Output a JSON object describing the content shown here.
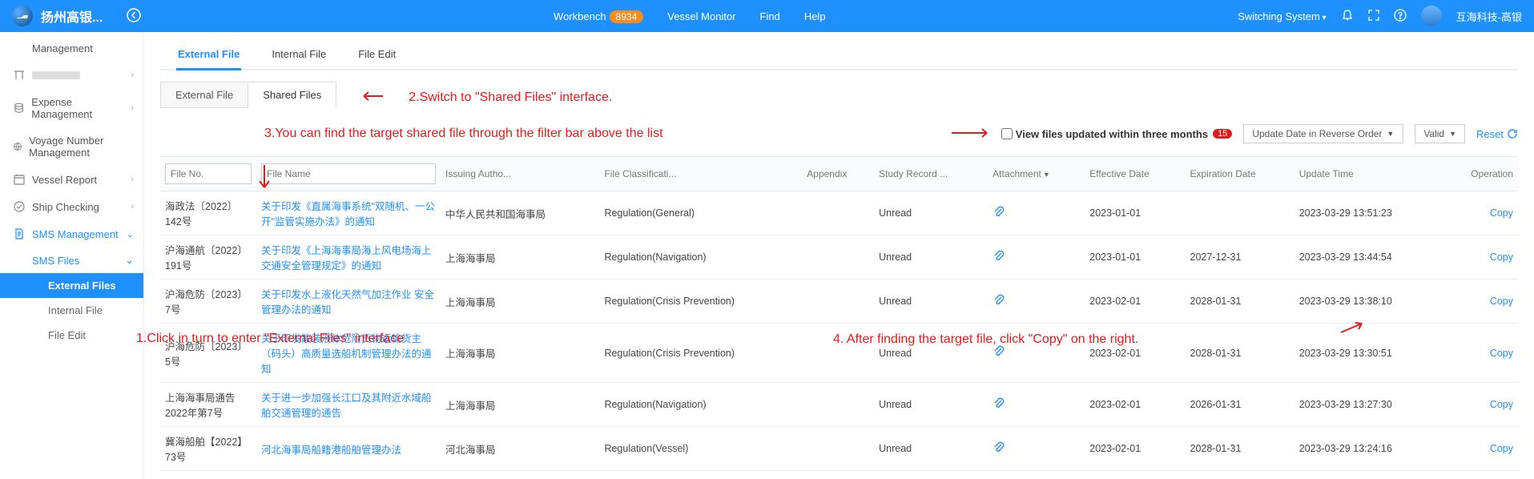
{
  "header": {
    "app_title": "扬州高银...",
    "nav": {
      "workbench": "Workbench",
      "workbench_badge": "8934",
      "vessel_monitor": "Vessel Monitor",
      "find": "Find",
      "help": "Help"
    },
    "right": {
      "switching": "Switching System",
      "user": "互海科技-高银"
    }
  },
  "sidebar": {
    "management": "Management",
    "blurred": "",
    "expense": "Expense Management",
    "voyage": "Voyage Number Management",
    "vessel_report": "Vessel Report",
    "ship_checking": "Ship Checking",
    "sms": "SMS Management",
    "sms_files": "SMS Files",
    "external_files": "External Files",
    "internal_file": "Internal File",
    "file_edit": "File Edit"
  },
  "tabs": {
    "external_file": "External File",
    "internal_file": "Internal File",
    "file_edit": "File Edit"
  },
  "subtabs": {
    "external_file": "External File",
    "shared_files": "Shared Files"
  },
  "notes": {
    "n1": "1.Click in turn to enter \"External Files\" interface",
    "n2": "2.Switch to \"Shared Files\" interface.",
    "n3": "3.You can find the target shared file through the filter bar above the list",
    "n4": "4. After finding the target file, click \"Copy\" on the right."
  },
  "filters": {
    "view_three_months": "View files updated within three months",
    "view_badge": "15",
    "order": "Update Date in Reverse Order",
    "valid": "Valid",
    "reset": "Reset"
  },
  "columns": {
    "file_no": "File No.",
    "file_name": "File Name",
    "issuing": "Issuing Autho...",
    "classification": "File Classificati...",
    "appendix": "Appendix",
    "study": "Study Record ...",
    "attachment": "Attachment",
    "effective": "Effective Date",
    "expiration": "Expiration Date",
    "update": "Update Time",
    "operation": "Operation"
  },
  "rows": [
    {
      "no": "海政法〔2022〕142号",
      "name": "关于印发《直属海事系统\"双随机、一公开\"监管实施办法》的通知",
      "auth": "中华人民共和国海事局",
      "cls": "Regulation(General)",
      "study": "Unread",
      "eff": "2023-01-01",
      "exp": "",
      "upd": "2023-03-29 13:51:23",
      "op": "Copy"
    },
    {
      "no": "沪海通航〔2022〕191号",
      "name": "关于印发《上海海事局海上风电场海上交通安全管理规定》的通知",
      "auth": "上海海事局",
      "cls": "Regulation(Navigation)",
      "study": "Unread",
      "eff": "2023-01-01",
      "exp": "2027-12-31",
      "upd": "2023-03-29 13:44:54",
      "op": "Copy"
    },
    {
      "no": "沪海危防〔2023〕7号",
      "name": "关于印发水上液化天然气加注作业 安全管理办法的通知",
      "auth": "上海海事局",
      "cls": "Regulation(Crisis Prevention)",
      "study": "Unread",
      "eff": "2023-02-01",
      "exp": "2028-01-31",
      "upd": "2023-03-29 13:38:10",
      "op": "Copy"
    },
    {
      "no": "沪海危防〔2023〕5号",
      "name": "关于印发散装液体危险货物运输货主（码头）高质量选船机制管理办法的通知",
      "auth": "上海海事局",
      "cls": "Regulation(Crisis Prevention)",
      "study": "Unread",
      "eff": "2023-02-01",
      "exp": "2028-01-31",
      "upd": "2023-03-29 13:30:51",
      "op": "Copy"
    },
    {
      "no": "上海海事局通告2022年第7号",
      "name": "关于进一步加强长江口及其附近水域船舶交通管理的通告",
      "auth": "上海海事局",
      "cls": "Regulation(Navigation)",
      "study": "Unread",
      "eff": "2023-02-01",
      "exp": "2026-01-31",
      "upd": "2023-03-29 13:27:30",
      "op": "Copy"
    },
    {
      "no": "冀海船舶【2022】73号",
      "name": "河北海事局船籍港船舶管理办法",
      "auth": "河北海事局",
      "cls": "Regulation(Vessel)",
      "study": "Unread",
      "eff": "2023-02-01",
      "exp": "2028-01-31",
      "upd": "2023-03-29 13:24:16",
      "op": "Copy"
    }
  ]
}
